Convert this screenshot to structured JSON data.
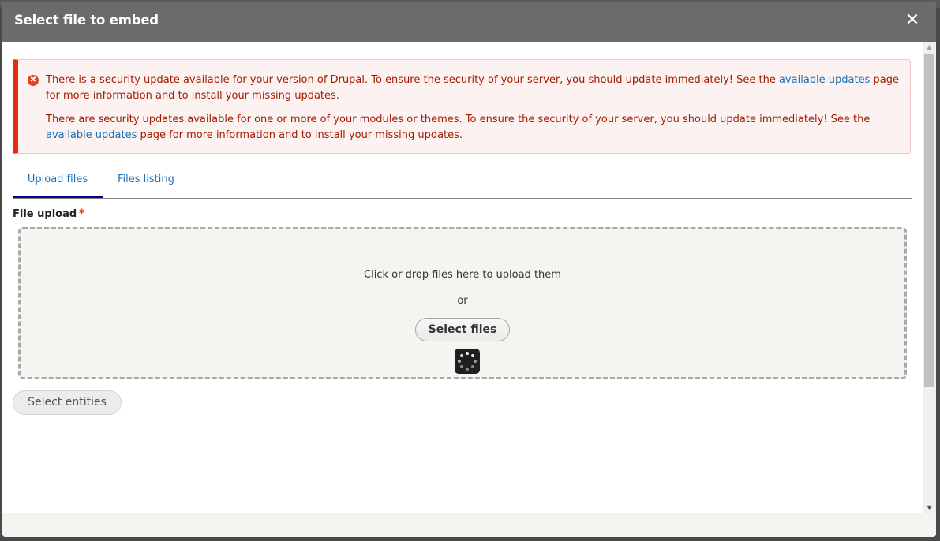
{
  "dialog": {
    "title": "Select file to embed",
    "close_icon": "✕"
  },
  "alert": {
    "icon": "✖",
    "messages": [
      {
        "before": "There is a security update available for your version of Drupal. To ensure the security of your server, you should update immediately! See the ",
        "link": "available updates",
        "after": " page for more information and to install your missing updates."
      },
      {
        "before": "There are security updates available for one or more of your modules or themes. To ensure the security of your server, you should update immediately! See the ",
        "link": "available updates",
        "after": " page for more information and to install your missing updates."
      }
    ],
    "colors": {
      "text": "#a51b00",
      "border": "#e52d0e",
      "bg": "#fcf2f1",
      "link": "#1b6fb6"
    }
  },
  "tabs": [
    {
      "label": "Upload files",
      "active": true
    },
    {
      "label": "Files listing",
      "active": false
    }
  ],
  "upload": {
    "label": "File upload",
    "required_marker": "*",
    "dropzone_text": "Click or drop files here to upload them",
    "or_text": "or",
    "select_button": "Select files"
  },
  "actions": {
    "select_entities": "Select entities"
  },
  "scrollbar": {
    "up_icon": "▲",
    "down_icon": "▼"
  }
}
